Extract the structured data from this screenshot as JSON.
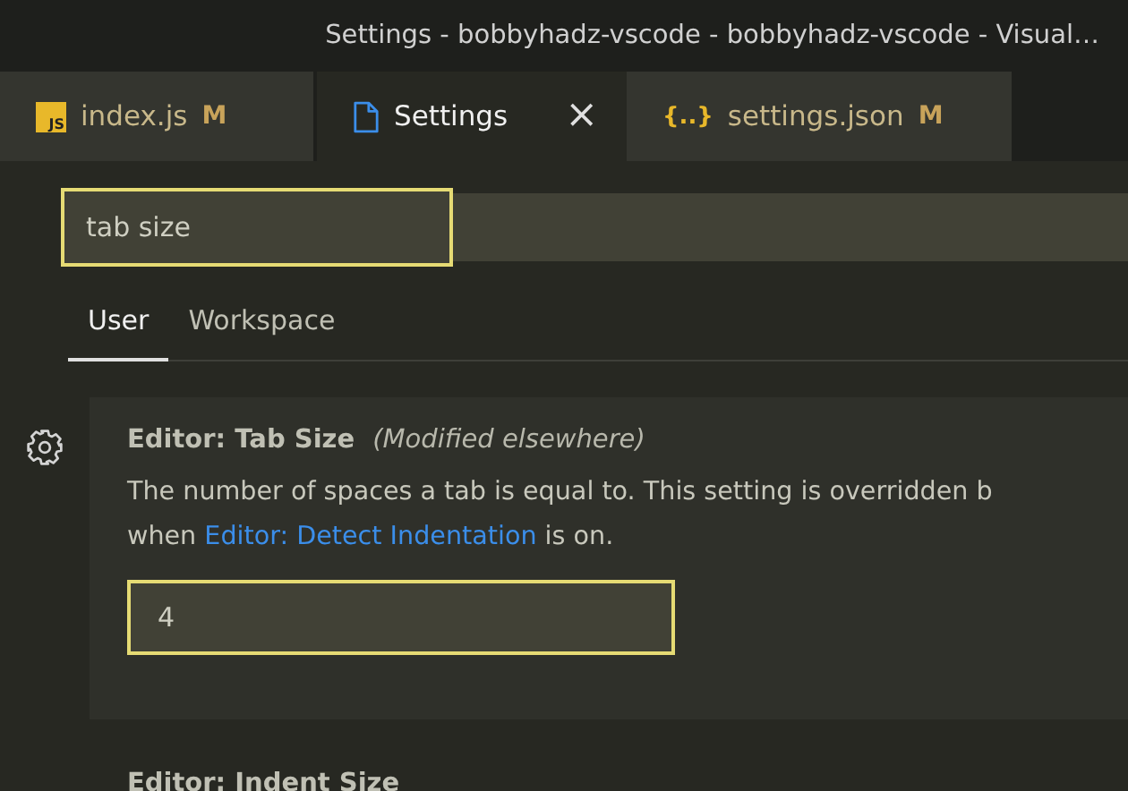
{
  "window": {
    "title": "Settings - bobbyhadz-vscode - bobbyhadz-vscode - Visual…"
  },
  "tabs": [
    {
      "kind": "js",
      "icon_text": "JS",
      "label": "index.js",
      "badge": "M",
      "selected": false
    },
    {
      "kind": "settings",
      "label": "Settings",
      "close": "×",
      "selected": true
    },
    {
      "kind": "json",
      "icon_text": "{..}",
      "label": "settings.json",
      "badge": "M",
      "selected": false
    }
  ],
  "search": {
    "value": "tab size"
  },
  "scope_tabs": [
    {
      "label": "User",
      "selected": true
    },
    {
      "label": "Workspace",
      "selected": false
    }
  ],
  "settings": [
    {
      "title": "Editor: **Tab Size**",
      "note": "(Modified elsewhere)",
      "description_lines": [
        "The number of spaces a tab is equal to. This setting is overridden b"
      ],
      "description_before": "when ",
      "link": "Editor: Detect Indentation",
      "description_after": " is on.",
      "value": "4"
    },
    {
      "title": "Editor: **Indent Size**"
    }
  ]
}
